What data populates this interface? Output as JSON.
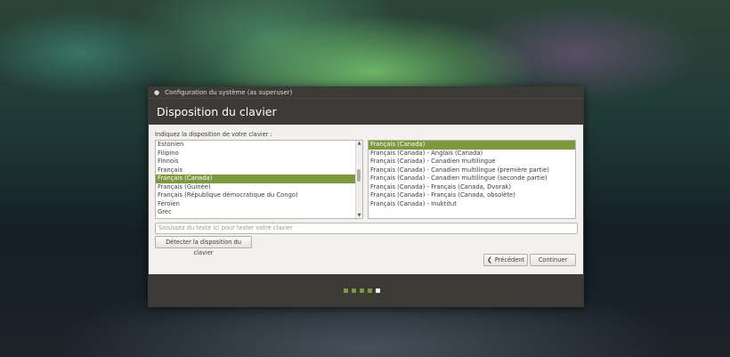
{
  "window": {
    "title": "Configuration du système (as superuser)",
    "close_icon": "close-icon"
  },
  "header": {
    "title": "Disposition du clavier"
  },
  "prompt": "Indiquez la disposition de votre clavier :",
  "layouts": {
    "items": [
      "Estonien",
      "Filipino",
      "Finnois",
      "Français",
      "Français (Canada)",
      "Français (Guinée)",
      "Français (République démocratique du Congo)",
      "Féroïen",
      "Grec"
    ],
    "selected_index": 4
  },
  "variants": {
    "items": [
      "Français (Canada)",
      "Français (Canada) - Anglais (Canada)",
      "Français (Canada) - Canadien multilingue",
      "Français (Canada) - Canadien multilingue (première partie)",
      "Français (Canada) - Canadien multilingue (seconde partie)",
      "Français (Canada) - Français (Canada, Dvorak)",
      "Français (Canada) - Français (Canada, obsolète)",
      "Français (Canada) - Inuktitut"
    ],
    "selected_index": 0
  },
  "test_input": {
    "placeholder": "Saisissez du texte ici pour tester votre clavier"
  },
  "buttons": {
    "detect": "Détecter la disposition du clavier",
    "previous": "Précédent",
    "continue": "Continuer"
  },
  "progress": {
    "total_steps": 5,
    "current_step": 5
  },
  "colors": {
    "accent": "#7c9a3d",
    "titlebar": "#3c3b37",
    "background": "#f2f1f0"
  }
}
